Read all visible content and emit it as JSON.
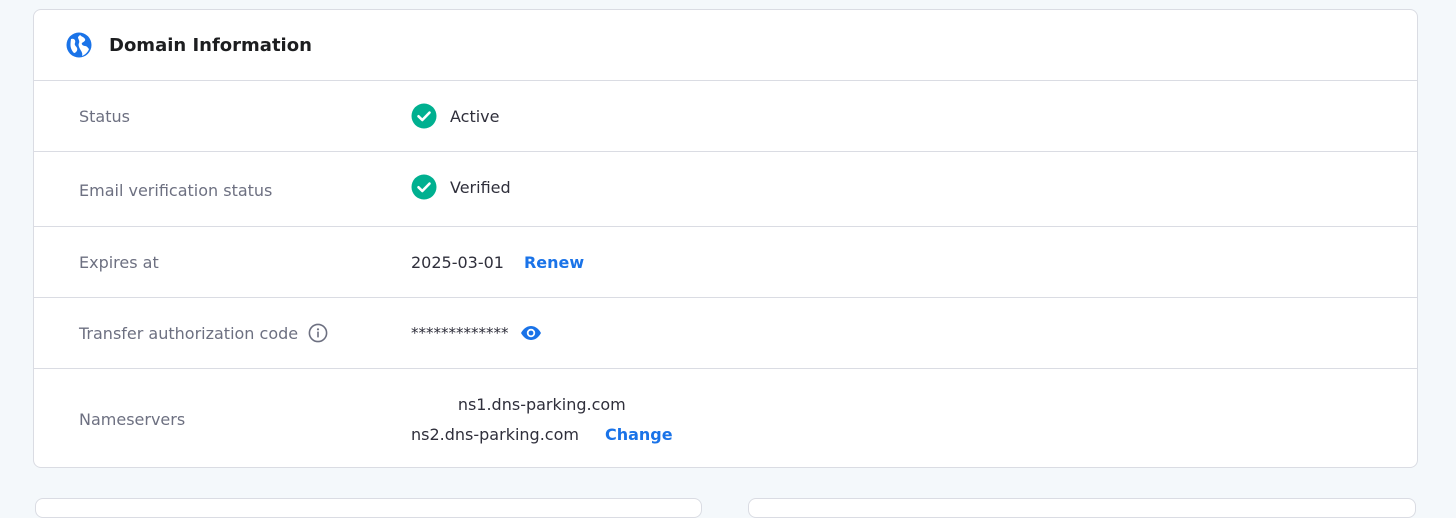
{
  "card": {
    "title": "Domain Information",
    "icon": "globe-icon"
  },
  "rows": {
    "status": {
      "label": "Status",
      "value": "Active",
      "icon": "check-circle-icon"
    },
    "email_verification": {
      "label": "Email verification status",
      "value": "Verified",
      "icon": "check-circle-icon"
    },
    "expires": {
      "label": "Expires at",
      "value": "2025-03-01",
      "action": "Renew"
    },
    "transfer_code": {
      "label": "Transfer authorization code",
      "value": "*************",
      "info_icon": "info-icon",
      "reveal_icon": "eye-icon"
    },
    "nameservers": {
      "label": "Nameservers",
      "values": [
        "ns1.dns-parking.com",
        "ns2.dns-parking.com"
      ],
      "action": "Change"
    }
  },
  "colors": {
    "accent": "#1a73e8",
    "success": "#00b090",
    "border": "#dadce3",
    "background": "#f4f8fb"
  }
}
